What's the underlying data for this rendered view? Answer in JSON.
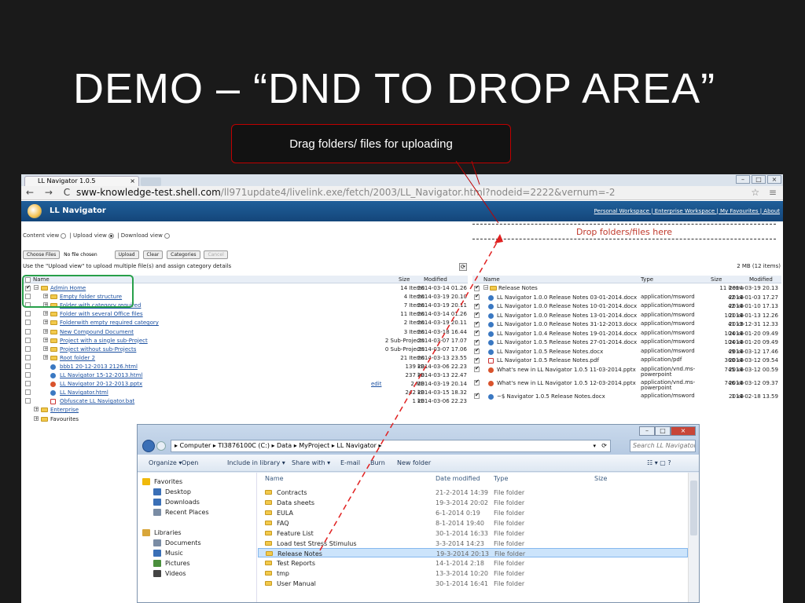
{
  "slide": {
    "title": "DEMO – “DND TO DROP AREA”",
    "callout": "Drag  folders/ files for uploading"
  },
  "browser": {
    "tab_title": "LL Navigator 1.0.5",
    "tab_close": "×",
    "nav_glyphs": "← → C",
    "url_host": "sww-knowledge-test.shell.com",
    "url_path": "/ll971update4/livelink.exe/fetch/2003/LL_Navigator.html?nodeid=2222&vernum=-2",
    "right_glyphs": "☆ ≡"
  },
  "app": {
    "name": "LL Navigator",
    "header_links": "Personal Workspace  |  Enterprise Workspace  |  My Favourites  |  About",
    "view_content": "Content view",
    "view_upload": "| Upload view",
    "view_download": "| Download view",
    "dropzone": "Drop folders/files here",
    "choose_files": "Choose Files",
    "no_file": "No file chosen",
    "btn_upload": "Upload",
    "btn_clear": "Clear",
    "btn_categories": "Categories",
    "btn_cancel": "Cancel",
    "hint": "Use the \"Upload view\" to upload multiple file(s) and assign category details",
    "right_size_info": "2 MB (12 items)",
    "refresh_glyph": "⟳"
  },
  "left_table": {
    "headers": {
      "name": "Name",
      "size": "Size",
      "modified": "Modified"
    },
    "rows": [
      {
        "name": "Admin Home",
        "size": "14 Items",
        "modified": "2014-03-14 01.26",
        "checked": true,
        "type": "folder"
      },
      {
        "name": "Empty folder structure",
        "size": "4 Items",
        "modified": "2014-03-19 20.10",
        "type": "folder"
      },
      {
        "name": "Folder with category required",
        "size": "7 Items",
        "modified": "2014-03-19 20.11",
        "type": "folder"
      },
      {
        "name": "Folder with several Office files",
        "size": "11 Items",
        "modified": "2014-03-14 01.26",
        "type": "folder"
      },
      {
        "name": "Folderwith empty required category",
        "size": "2 Items",
        "modified": "2014-03-19 20.11",
        "type": "folder"
      },
      {
        "name": "New Compound Document",
        "size": "3 Items",
        "modified": "2014-03-18 16.44",
        "type": "folder"
      },
      {
        "name": "Project with a single sub-Project",
        "size": "2 Sub-Projects",
        "modified": "2014-03-07 17.07",
        "type": "project"
      },
      {
        "name": "Project without sub-Projects",
        "size": "0 Sub-Projects",
        "modified": "2014-03-07 17.06",
        "type": "project"
      },
      {
        "name": "Root folder 2",
        "size": "21 Items",
        "modified": "2014-03-13 23.55",
        "type": "folder"
      },
      {
        "name": "bbb1 20-12-2013 2126.html",
        "size": "139 kB",
        "modified": "2014-03-06 22.23",
        "type": "doc"
      },
      {
        "name": "LL Navigator 15-12-2013.html",
        "size": "237 kB",
        "modified": "2014-03-13 22.47",
        "type": "doc"
      },
      {
        "name": "LL Navigator 20-12-2013.pptx",
        "size": "2 MB",
        "modified": "2014-03-19 20.14",
        "type": "ppt",
        "extra": "edit"
      },
      {
        "name": "LL Navigator.html",
        "size": "242 kB",
        "modified": "2014-03-15 18.32",
        "type": "doc"
      },
      {
        "name": "Obfuscate LL Navigator.bat",
        "size": "1 kB",
        "modified": "2014-03-06 22.23",
        "type": "file"
      },
      {
        "name": "Enterprise",
        "size": "",
        "modified": "",
        "type": "folder"
      },
      {
        "name": "Favourites",
        "size": "",
        "modified": "",
        "type": "folder"
      }
    ]
  },
  "right_table": {
    "headers": {
      "name": "Name",
      "type": "Type",
      "size": "Size",
      "modified": "Modified"
    },
    "rows": [
      {
        "name": "Release Notes",
        "type": "",
        "size": "11 items",
        "modified": "2014-03-19 20.13",
        "kind": "folder"
      },
      {
        "name": "LL Navigator 1.0.0 Release Notes 03-01-2014.docx",
        "type": "application/msword",
        "size": "42 kB",
        "modified": "2014-01-03 17.27",
        "kind": "doc"
      },
      {
        "name": "LL Navigator 1.0.0 Release Notes 10-01-2014.docx",
        "type": "application/msword",
        "size": "42 kB",
        "modified": "2014-01-10 17.13",
        "kind": "doc"
      },
      {
        "name": "LL Navigator 1.0.0 Release Notes 13-01-2014.docx",
        "type": "application/msword",
        "size": "101 kB",
        "modified": "2014-01-13 12.26",
        "kind": "doc"
      },
      {
        "name": "LL Navigator 1.0.0 Release Notes 31-12-2013.docx",
        "type": "application/msword",
        "size": "41 kB",
        "modified": "2013-12-31 12.33",
        "kind": "doc"
      },
      {
        "name": "LL Navigator 1.0.4 Release Notes 19-01-2014.docx",
        "type": "application/msword",
        "size": "104 kB",
        "modified": "2014-01-20 09.49",
        "kind": "doc"
      },
      {
        "name": "LL Navigator 1.0.5 Release Notes 27-01-2014.docx",
        "type": "application/msword",
        "size": "104 kB",
        "modified": "2014-01-20 09.49",
        "kind": "doc"
      },
      {
        "name": "LL Navigator 1.0.5 Release Notes.docx",
        "type": "application/msword",
        "size": "49 kB",
        "modified": "2014-03-12 17.46",
        "kind": "doc"
      },
      {
        "name": "LL Navigator 1.0.5 Release Notes.pdf",
        "type": "application/pdf",
        "size": "360 kB",
        "modified": "2014-03-12 09.54",
        "kind": "pdf"
      },
      {
        "name": "What's new in LL Navigator 1.0.5 11-03-2014.pptx",
        "type": "application/vnd.ms-powerpoint",
        "size": "745 kB",
        "modified": "2014-03-12 00.59",
        "kind": "ppt"
      },
      {
        "name": "What's new in LL Navigator 1.0.5 12-03-2014.pptx",
        "type": "application/vnd.ms-powerpoint",
        "size": "746 kB",
        "modified": "2014-03-12 09.37",
        "kind": "ppt"
      },
      {
        "name": "~$ Navigator 1.0.5 Release Notes.docx",
        "type": "application/msword",
        "size": "1 kB",
        "modified": "2014-02-18 13.59",
        "kind": "doc"
      }
    ]
  },
  "explorer": {
    "path": "▸ Computer ▸ TI3876100C (C:) ▸ Data ▸ MyProject ▸ LL Navigator ▸",
    "search_placeholder": "Search LL Navigator",
    "toolbar": [
      "Organize ▾",
      "Open",
      "Include in library ▾",
      "Share with ▾",
      "E-mail",
      "Burn",
      "New folder"
    ],
    "sidebar": [
      {
        "label": "Favorites",
        "color": "#f0b90b"
      },
      {
        "label": "Desktop",
        "color": "#3a6fb6"
      },
      {
        "label": "Downloads",
        "color": "#3a6fb6"
      },
      {
        "label": "Recent Places",
        "color": "#7a8ca4"
      },
      {
        "label": "Libraries",
        "color": "#d8a63a"
      },
      {
        "label": "Documents",
        "color": "#7a8ca4"
      },
      {
        "label": "Music",
        "color": "#3a6fb6"
      },
      {
        "label": "Pictures",
        "color": "#4a8f3c"
      },
      {
        "label": "Videos",
        "color": "#444444"
      }
    ],
    "headers": {
      "name": "Name",
      "date": "Date modified",
      "type": "Type",
      "size": "Size"
    },
    "rows": [
      {
        "name": "Contracts",
        "date": "21-2-2014 14:39",
        "type": "File folder"
      },
      {
        "name": "Data sheets",
        "date": "19-3-2014 20:02",
        "type": "File folder"
      },
      {
        "name": "EULA",
        "date": "6-1-2014 0:19",
        "type": "File folder"
      },
      {
        "name": "FAQ",
        "date": "8-1-2014 19:40",
        "type": "File folder"
      },
      {
        "name": "Feature List",
        "date": "30-1-2014 16:33",
        "type": "File folder"
      },
      {
        "name": "Load test Stress Stimulus",
        "date": "3-3-2014 14:23",
        "type": "File folder"
      },
      {
        "name": "Release Notes",
        "date": "19-3-2014 20:13",
        "type": "File folder",
        "selected": true
      },
      {
        "name": "Test Reports",
        "date": "14-1-2014 2:18",
        "type": "File folder"
      },
      {
        "name": "tmp",
        "date": "13-3-2014 10:20",
        "type": "File folder"
      },
      {
        "name": "User Manual",
        "date": "30-1-2014 16:41",
        "type": "File folder"
      }
    ]
  }
}
